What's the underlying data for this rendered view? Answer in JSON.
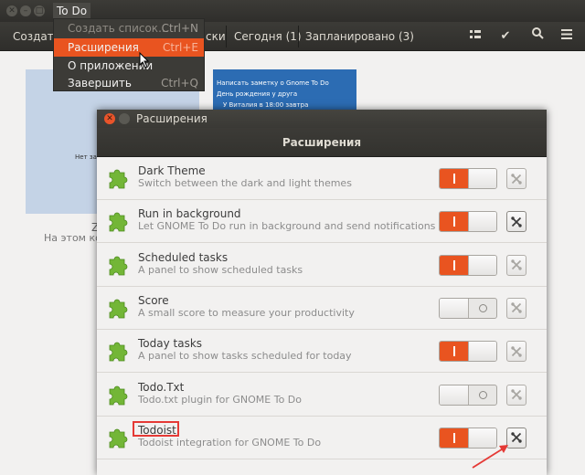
{
  "window": {
    "title": "To Do"
  },
  "headerbar": {
    "create_label": "Создать",
    "tab_lists": "ски",
    "tab_today": "Сегодня (1)",
    "tab_scheduled": "Запланировано (3)",
    "icons": [
      "list-view-icon",
      "check-icon",
      "search-icon",
      "menu-icon"
    ]
  },
  "app_menu": {
    "items": [
      {
        "label": "Создать список…",
        "shortcut": "Ctrl+N",
        "state": "disabled"
      },
      {
        "label": "Расширения",
        "shortcut": "Ctrl+E",
        "state": "active"
      },
      {
        "label": "О приложении",
        "shortcut": "",
        "state": "normal"
      },
      {
        "label": "Завершить",
        "shortcut": "Ctrl+Q",
        "state": "normal"
      }
    ]
  },
  "content": {
    "card_left_text": "Нет за",
    "card_right_lines": [
      "Написать заметку о Gnome To Do",
      "День рождения у друга",
      "У Виталия в 18:00 завтра"
    ],
    "empty_title": "Z",
    "empty_subtitle": "На этом ко"
  },
  "dialog": {
    "window_title": "Расширения",
    "header_title": "Расширения",
    "extensions": [
      {
        "name": "Dark Theme",
        "description": "Switch between the dark and light themes",
        "enabled": true,
        "preferences_enabled": false
      },
      {
        "name": "Run in background",
        "description": "Let GNOME To Do run in background and send notifications",
        "enabled": true,
        "preferences_enabled": true
      },
      {
        "name": "Scheduled tasks",
        "description": "A panel to show scheduled tasks",
        "enabled": true,
        "preferences_enabled": false
      },
      {
        "name": "Score",
        "description": "A small score to measure your productivity",
        "enabled": false,
        "preferences_enabled": false
      },
      {
        "name": "Today tasks",
        "description": "A panel to show tasks scheduled for today",
        "enabled": true,
        "preferences_enabled": false
      },
      {
        "name": "Todo.Txt",
        "description": "Todo.txt plugin for GNOME To Do",
        "enabled": false,
        "preferences_enabled": false
      },
      {
        "name": "Todoist",
        "description": "Todoist integration for GNOME To Do",
        "enabled": true,
        "preferences_enabled": true
      }
    ]
  },
  "colors": {
    "accent": "#e95420",
    "highlight_box": "#e53935",
    "puzzle_green": "#73b637"
  }
}
